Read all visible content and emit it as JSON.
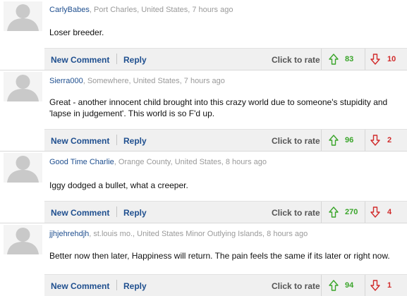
{
  "comments": [
    {
      "author": "CarlyBabes",
      "meta": ", Port Charles, United States, 7 hours ago",
      "text": "Loser breeder.",
      "new_comment": "New Comment",
      "reply": "Reply",
      "rate_label": "Click to rate",
      "up": "83",
      "down": "10"
    },
    {
      "author": "Sierra000",
      "meta": ", Somewhere, United States, 7 hours ago",
      "text": "Great - another innocent child brought into this crazy world due to someone's stupidity and 'lapse in judgement'. This world is so F'd up.",
      "new_comment": "New Comment",
      "reply": "Reply",
      "rate_label": "Click to rate",
      "up": "96",
      "down": "2"
    },
    {
      "author": "Good Time Charlie",
      "meta": ", Orange County, United States, 8 hours ago",
      "text": "Iggy dodged a bullet, what a creeper.",
      "new_comment": "New Comment",
      "reply": "Reply",
      "rate_label": "Click to rate",
      "up": "270",
      "down": "4"
    },
    {
      "author": "jjhjehrehdjh",
      "meta": ", st.louis mo., United States Minor Outlying Islands, 8 hours ago",
      "text": "Better now then later, Happiness will return. The pain feels the same if its later or right now.",
      "new_comment": "New Comment",
      "reply": "Reply",
      "rate_label": "Click to rate",
      "up": "94",
      "down": "1"
    }
  ],
  "icons": {
    "avatar": "default-user-silhouette-icon",
    "up": "arrow-up-icon",
    "down": "arrow-down-icon"
  },
  "colors": {
    "link": "#1f4f8f",
    "up": "#3aa52a",
    "down": "#d12b2b",
    "action_bar": "#f0f0f0"
  }
}
